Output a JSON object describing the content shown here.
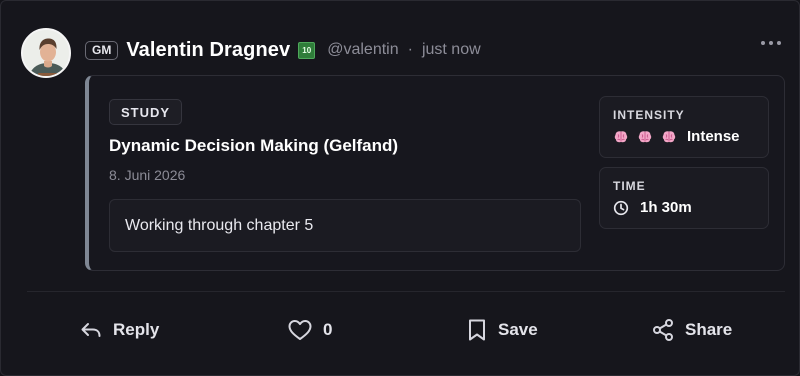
{
  "post": {
    "role_badge": "GM",
    "username": "Valentin Dragnev",
    "level": "10",
    "handle": "@valentin",
    "separator": "·",
    "timestamp": "just now"
  },
  "activity": {
    "tag": "STUDY",
    "title": "Dynamic Decision Making (Gelfand)",
    "date": "8. Juni 2026",
    "note": "Working through chapter 5",
    "intensity": {
      "label": "INTENSITY",
      "value": "Intense",
      "icons": [
        "brain-icon",
        "brain-icon",
        "brain-icon"
      ]
    },
    "time": {
      "label": "TIME",
      "value": "1h 30m",
      "icon": "clock-icon"
    }
  },
  "actions": {
    "reply": "Reply",
    "like_count": "0",
    "save": "Save",
    "share": "Share"
  },
  "colors": {
    "background": "#16161c",
    "accent_bar": "#7f8794",
    "level_badge": "#2f7d3a",
    "brain": "#f3a6c7"
  }
}
